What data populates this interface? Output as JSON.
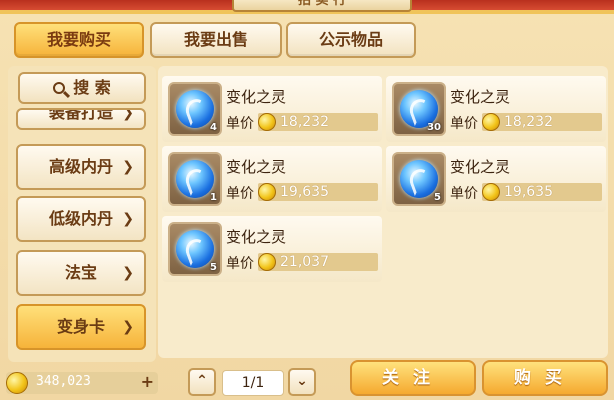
{
  "header": {
    "title": "拍 卖 行"
  },
  "tabs": [
    {
      "label": "我要购买",
      "active": true
    },
    {
      "label": "我要出售",
      "active": false
    },
    {
      "label": "公示物品",
      "active": false
    }
  ],
  "sidebar": {
    "search_label": "搜 索",
    "items": [
      {
        "label": "装备打造",
        "active": false
      },
      {
        "label": "高级内丹",
        "active": false
      },
      {
        "label": "低级内丹",
        "active": false
      },
      {
        "label": "法宝",
        "active": false
      },
      {
        "label": "变身卡",
        "active": true
      }
    ]
  },
  "listings": [
    {
      "name": "变化之灵",
      "qty": "4",
      "price_label": "单价",
      "price": "18,232"
    },
    {
      "name": "变化之灵",
      "qty": "30",
      "price_label": "单价",
      "price": "18,232"
    },
    {
      "name": "变化之灵",
      "qty": "1",
      "price_label": "单价",
      "price": "19,635"
    },
    {
      "name": "变化之灵",
      "qty": "5",
      "price_label": "单价",
      "price": "19,635"
    },
    {
      "name": "变化之灵",
      "qty": "5",
      "price_label": "单价",
      "price": "21,037"
    }
  ],
  "footer": {
    "money": "348,023",
    "plus": "+",
    "prev": "⌃",
    "next": "⌄",
    "page": "1/1",
    "follow_label": "关注",
    "buy_label": "购买"
  },
  "icons": {
    "currency": "gold-coin-icon",
    "item": "blue-orb-icon"
  },
  "colors": {
    "accent": "#f6b33a",
    "panel": "#f8ebcb"
  }
}
